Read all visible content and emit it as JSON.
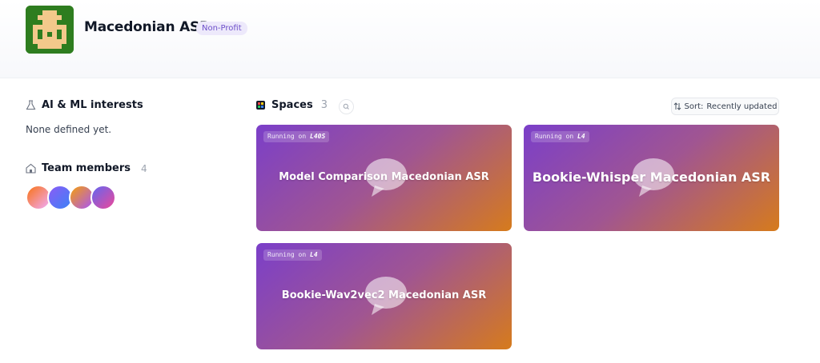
{
  "org": {
    "name": "Macedonian ASR",
    "badge": "Non-Profit",
    "avatar_icon": "pixel-art-logo-icon",
    "avatar_colors": {
      "background": "#2e7d1f",
      "figure": "#f3c98b"
    }
  },
  "sidebar": {
    "interests": {
      "icon": "flask-icon",
      "title": "AI & ML interests",
      "text": "None defined yet."
    },
    "team": {
      "icon": "team-icon",
      "title": "Team members",
      "count": "4",
      "member_colors": [
        [
          "#f97316",
          "#f0abfc"
        ],
        [
          "#8b5cf6",
          "#3b82f6"
        ],
        [
          "#f59e0b",
          "#a855f7"
        ],
        [
          "#6366f1",
          "#ec4899"
        ]
      ]
    }
  },
  "spaces": {
    "icon": "spaces-icon",
    "title": "Spaces",
    "count": "3",
    "search_icon": "search-icon",
    "sort": {
      "icon": "sort-arrows-icon",
      "label": "Sort:",
      "value": "Recently updated"
    },
    "cards": [
      {
        "running_prefix": "Running on",
        "hardware": "L40S",
        "title": "Model Comparison Macedonian ASR"
      },
      {
        "running_prefix": "Running on",
        "hardware": "L4",
        "title": "Bookie-Whisper Macedonian ASR"
      },
      {
        "running_prefix": "Running on",
        "hardware": "L4",
        "title": "Bookie-Wav2vec2 Macedonian ASR"
      }
    ],
    "card_gradient": [
      "#7b3fc9",
      "#a05592",
      "#d67b1c"
    ]
  }
}
